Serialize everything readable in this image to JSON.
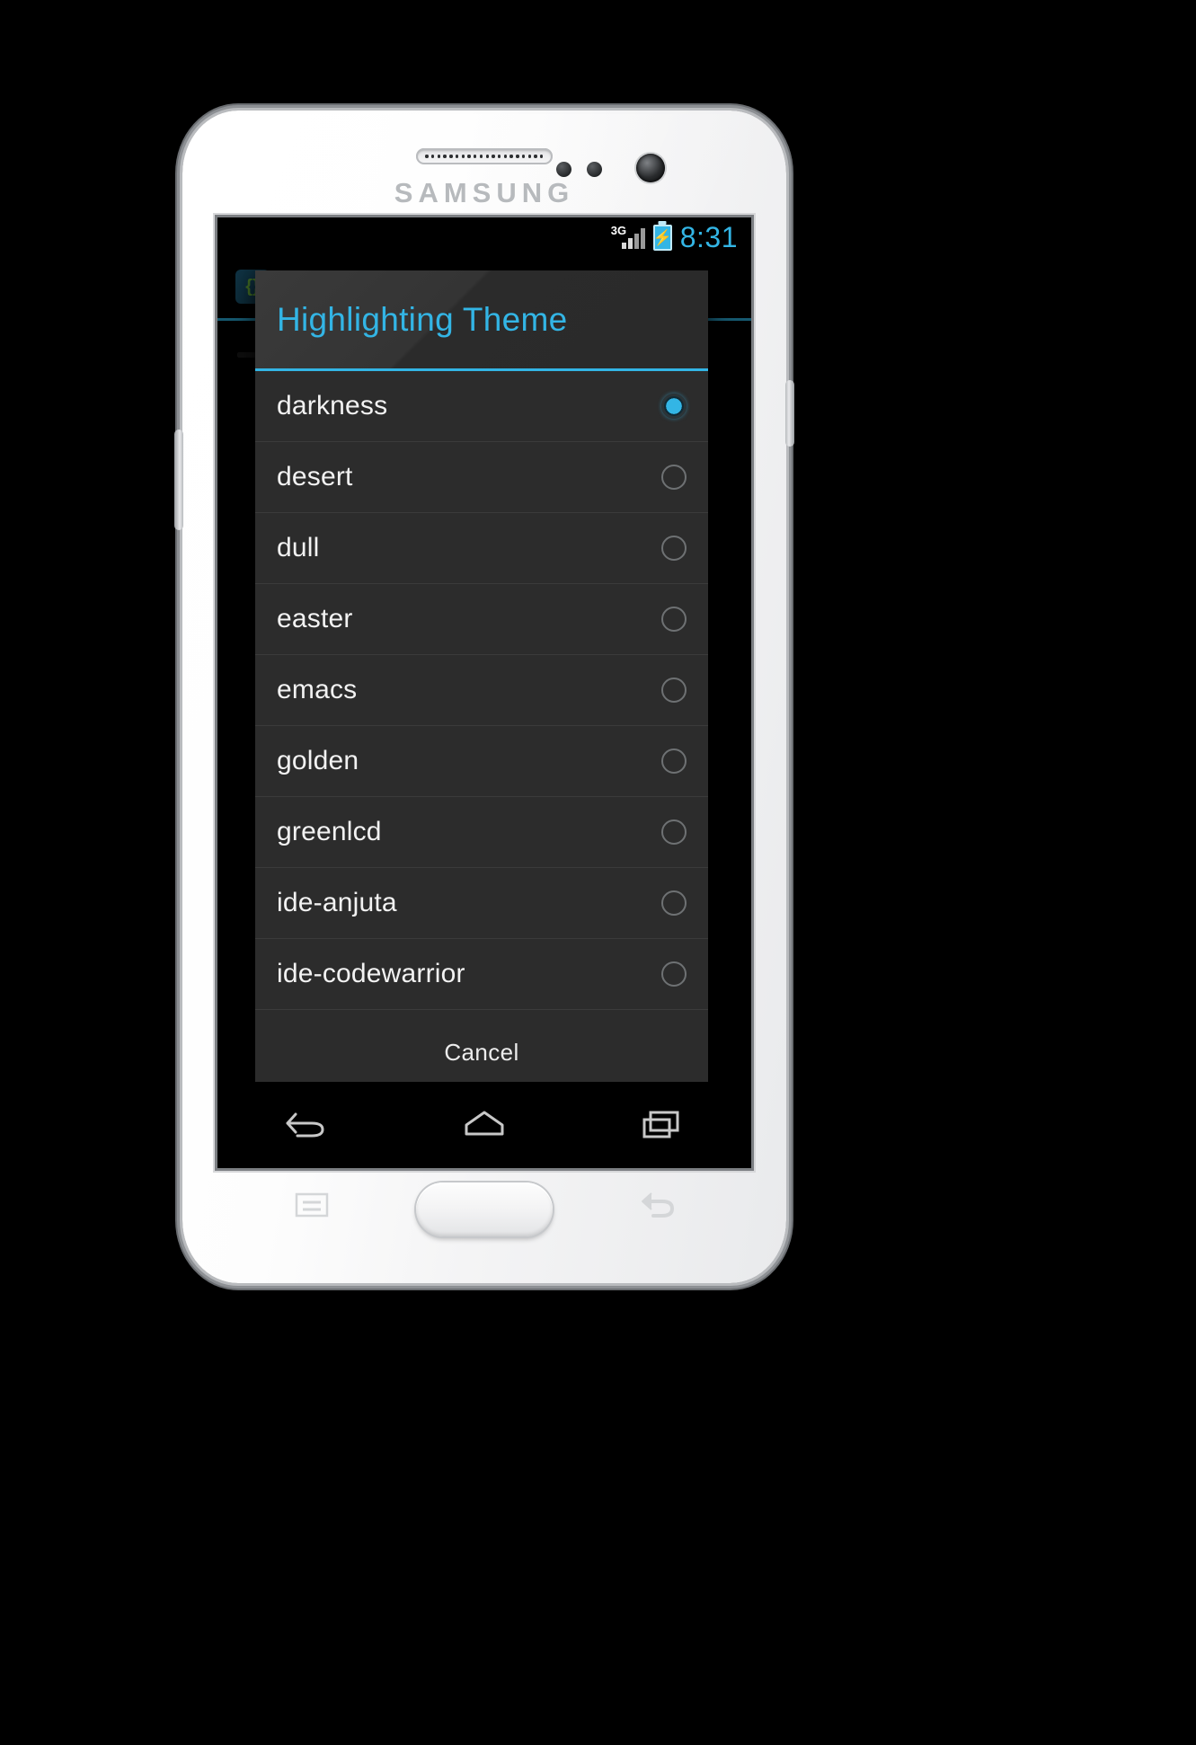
{
  "device": {
    "brand": "SAMSUNG",
    "speaker_icon": "speaker-grille-icon",
    "front_camera_icon": "front-camera-icon",
    "proximity_sensor_icon": "proximity-sensor-icon",
    "light_sensor_icon": "light-sensor-icon",
    "hardware_menu_icon": "menu-icon",
    "hardware_home_label": "home-button",
    "hardware_back_icon": "back-arrow-icon",
    "volume_rocker": "volume-rocker",
    "power_button": "power-button"
  },
  "statusbar": {
    "network_type": "3G",
    "signal_icon": "signal-bars-icon",
    "battery_icon": "battery-charging-icon",
    "battery_bolt": "⚡",
    "time": "8:31"
  },
  "background_app": {
    "app_icon": "app-launcher-icon",
    "app_icon_glyph": "{}",
    "actionbar_accent": "#29a3cc"
  },
  "dialog": {
    "title": "Highlighting Theme",
    "accent_color": "#33b5e5",
    "selected_value": "darkness",
    "options": [
      {
        "label": "darkness",
        "selected": true
      },
      {
        "label": "desert",
        "selected": false
      },
      {
        "label": "dull",
        "selected": false
      },
      {
        "label": "easter",
        "selected": false
      },
      {
        "label": "emacs",
        "selected": false
      },
      {
        "label": "golden",
        "selected": false
      },
      {
        "label": "greenlcd",
        "selected": false
      },
      {
        "label": "ide-anjuta",
        "selected": false
      },
      {
        "label": "ide-codewarrior",
        "selected": false
      }
    ],
    "cancel_label": "Cancel"
  },
  "navbar": {
    "back_icon": "back-arrow-icon",
    "home_icon": "home-icon",
    "recents_icon": "recent-apps-icon"
  }
}
